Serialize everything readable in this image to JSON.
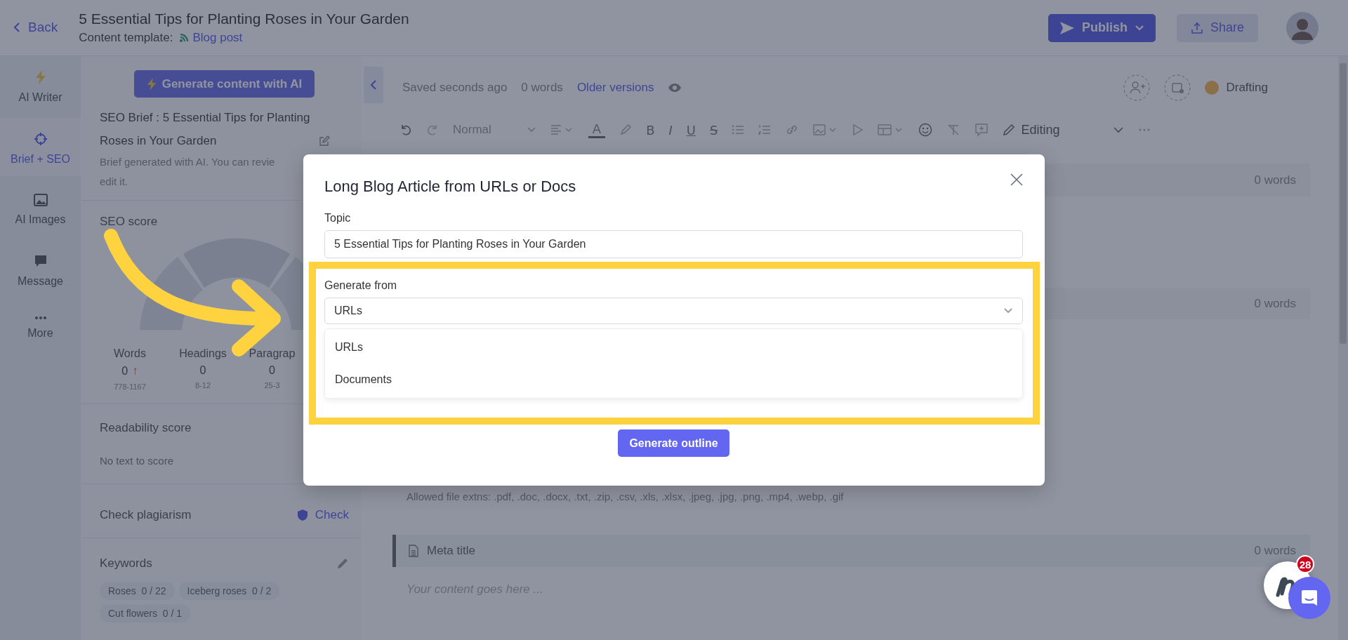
{
  "header": {
    "back": "Back",
    "title": "5 Essential Tips for Planting Roses in Your Garden",
    "template_label": "Content template:",
    "template": "Blog post",
    "publish": "Publish",
    "share": "Share"
  },
  "rail": [
    {
      "kind": "bolt",
      "label": "AI Writer",
      "selected": false
    },
    {
      "kind": "target",
      "label": "Brief + SEO",
      "selected": true
    },
    {
      "kind": "image",
      "label": "AI Images",
      "selected": false
    },
    {
      "kind": "chat",
      "label": "Message",
      "selected": false
    },
    {
      "kind": "dots",
      "label": "More",
      "selected": false
    }
  ],
  "brief_panel": {
    "generate_button": "Generate content with AI",
    "brief_title": "SEO Brief : 5 Essential Tips for Planting Roses in Your Garden",
    "brief_note": [
      "Brief generated with AI. You can revie",
      "edit it."
    ],
    "seo_score": {
      "title": "SEO score",
      "stats": [
        {
          "label": "Words",
          "value": "0",
          "range": "778-1167",
          "trend": "↑"
        },
        {
          "label": "Headings",
          "value": "0",
          "range": "8-12"
        },
        {
          "label": "Paragrap",
          "value": "0",
          "range": "25-3"
        }
      ]
    },
    "readability": {
      "title": "Readability score",
      "text": "No text to score"
    },
    "plagiarism": {
      "title": "Check plagiarism",
      "action": "Check"
    },
    "keywords": {
      "title": "Keywords",
      "items": [
        {
          "label": "Roses",
          "count": "0 / 22"
        },
        {
          "label": "Iceberg roses",
          "count": "0 / 2"
        },
        {
          "label": "Cut flowers",
          "count": "0 / 1"
        }
      ]
    }
  },
  "editor": {
    "saved": "Saved seconds ago",
    "word_count": "0 words",
    "older_versions": "Older versions",
    "status": {
      "label": "Drafting"
    },
    "toolbar": {
      "style": "Normal",
      "text_color_key": "A",
      "format_keys": [
        "B",
        "I",
        "U",
        "S"
      ],
      "mode": "Editing"
    },
    "sections": [
      {
        "words": "0 words"
      },
      {
        "words": "0 words"
      }
    ],
    "allowed_files": "Allowed file extns: .pdf, .doc, .docx, .txt, .zip, .csv, .xls, .xlsx, .jpeg, .jpg, .png, .mp4, .webp, .gif",
    "meta": {
      "title": "Meta title",
      "placeholder": "Your content goes here ...",
      "words": "0 words"
    }
  },
  "modal": {
    "title": "Long Blog Article from URLs or Docs",
    "topic_label": "Topic",
    "topic_value": "5 Essential Tips for Planting Roses in Your Garden",
    "source_label": "Generate from",
    "source_value": "URLs",
    "options": [
      "URLs",
      "Documents"
    ],
    "generate_button": "Generate outline"
  },
  "chat_widget": {
    "badge": "28"
  }
}
